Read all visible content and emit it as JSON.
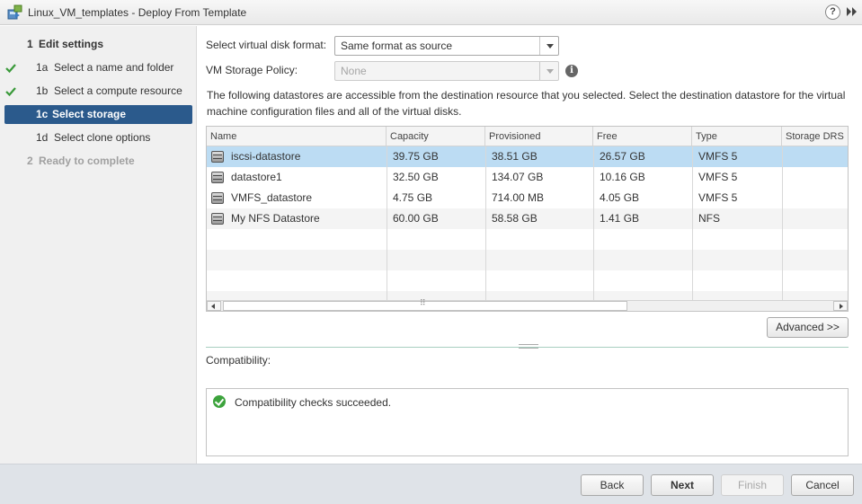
{
  "window": {
    "title": "Linux_VM_templates - Deploy From Template",
    "help_label": "?"
  },
  "steps": [
    {
      "num": "1",
      "label": "Edit settings",
      "state": "heading",
      "done": false
    },
    {
      "num": "1a",
      "label": "Select a name and folder",
      "state": "normal",
      "done": true
    },
    {
      "num": "1b",
      "label": "Select a compute resource",
      "state": "normal",
      "done": true
    },
    {
      "num": "1c",
      "label": "Select storage",
      "state": "active",
      "done": true
    },
    {
      "num": "1d",
      "label": "Select clone options",
      "state": "normal",
      "done": false
    },
    {
      "num": "2",
      "label": "Ready to complete",
      "state": "disabled",
      "done": false
    }
  ],
  "form": {
    "disk_format_label": "Select virtual disk format:",
    "disk_format_value": "Same format as source",
    "policy_label": "VM Storage Policy:",
    "policy_value": "None",
    "info_icon": "i",
    "description": "The following datastores are accessible from the destination resource that you selected. Select the destination datastore for the virtual machine configuration files and all of the virtual disks."
  },
  "table": {
    "columns": [
      "Name",
      "Capacity",
      "Provisioned",
      "Free",
      "Type",
      "Storage DRS"
    ],
    "rows": [
      {
        "name": "iscsi-datastore",
        "capacity": "39.75 GB",
        "provisioned": "38.51 GB",
        "free": "26.57 GB",
        "type": "VMFS 5",
        "drs": "",
        "selected": true
      },
      {
        "name": "datastore1",
        "capacity": "32.50 GB",
        "provisioned": "134.07 GB",
        "free": "10.16 GB",
        "type": "VMFS 5",
        "drs": "",
        "selected": false
      },
      {
        "name": "VMFS_datastore",
        "capacity": "4.75 GB",
        "provisioned": "714.00 MB",
        "free": "4.05 GB",
        "type": "VMFS 5",
        "drs": "",
        "selected": false
      },
      {
        "name": "My NFS Datastore",
        "capacity": "60.00 GB",
        "provisioned": "58.58 GB",
        "free": "1.41 GB",
        "type": "NFS",
        "drs": "",
        "selected": false
      }
    ]
  },
  "advanced_button": "Advanced >>",
  "compatibility": {
    "label": "Compatibility:",
    "message": "Compatibility checks succeeded."
  },
  "footer": {
    "back": "Back",
    "next": "Next",
    "finish": "Finish",
    "cancel": "Cancel"
  },
  "colors": {
    "active_step": "#2b5a8c",
    "selected_row": "#bcdcf3",
    "check": "#3a9a3a"
  }
}
